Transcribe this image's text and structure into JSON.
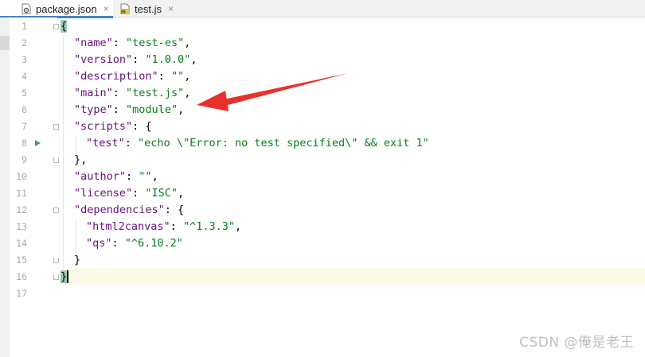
{
  "tabs": [
    {
      "label": "package.json",
      "icon": "json-file-icon",
      "active": true
    },
    {
      "label": "test.js",
      "icon": "js-file-icon",
      "active": false
    }
  ],
  "tab_close_glyph": "×",
  "line_numbers": [
    "1",
    "2",
    "3",
    "4",
    "5",
    "6",
    "7",
    "8",
    "9",
    "10",
    "11",
    "12",
    "13",
    "14",
    "15",
    "16",
    "17"
  ],
  "code": {
    "l1": "{",
    "name_key": "\"name\"",
    "name_val": "\"test-es\"",
    "version_key": "\"version\"",
    "version_val": "\"1.0.0\"",
    "description_key": "\"description\"",
    "description_val": "\"\"",
    "main_key": "\"main\"",
    "main_val": "\"test.js\"",
    "type_key": "\"type\"",
    "type_val": "\"module\"",
    "scripts_key": "\"scripts\"",
    "test_key": "\"test\"",
    "test_val": "\"echo \\\"Error: no test specified\\\" && exit 1\"",
    "scripts_close": "},",
    "author_key": "\"author\"",
    "author_val": "\"\"",
    "license_key": "\"license\"",
    "license_val": "\"ISC\"",
    "dependencies_key": "\"dependencies\"",
    "html2canvas_key": "\"html2canvas\"",
    "html2canvas_val": "\"^1.3.3\"",
    "qs_key": "\"qs\"",
    "qs_val": "\"^6.10.2\"",
    "deps_close": "}",
    "l16": "}"
  },
  "colors": {
    "key": "#660e7a",
    "string": "#067d17",
    "arrow": "#e8312a",
    "active_tab_underline": "#4083c9",
    "current_line": "#fcfae6",
    "brace_highlight": "#99ccbb",
    "run_icon": "#499c54"
  },
  "watermark": "CSDN @俺是老王"
}
